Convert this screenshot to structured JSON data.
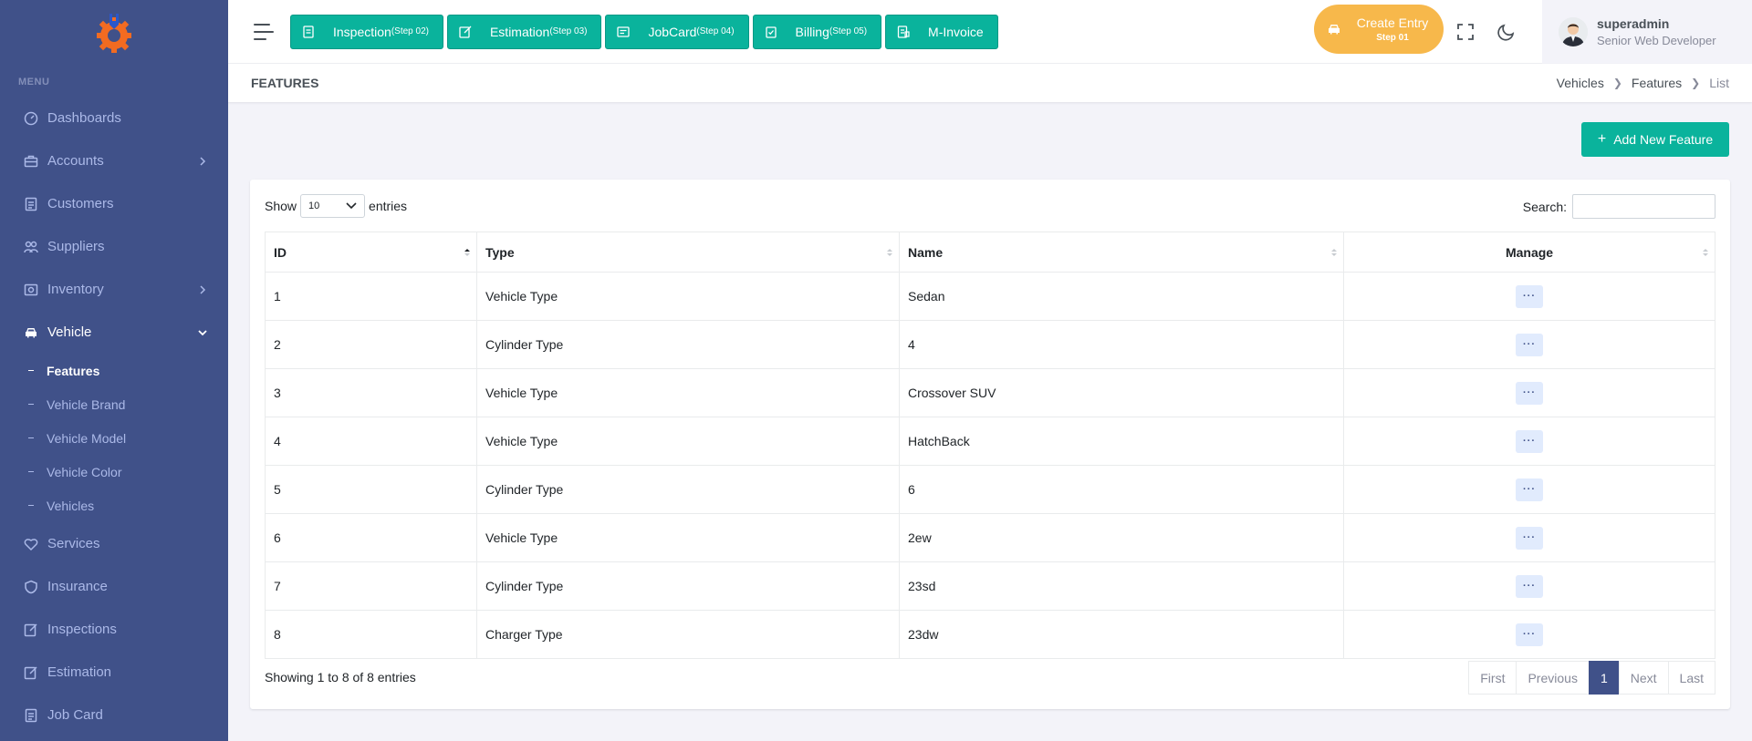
{
  "sidebar": {
    "menu_title": "MENU",
    "items": [
      {
        "label": "Dashboards",
        "icon": "dashboard-icon"
      },
      {
        "label": "Accounts",
        "icon": "briefcase-icon",
        "has_children": true
      },
      {
        "label": "Customers",
        "icon": "file-icon"
      },
      {
        "label": "Suppliers",
        "icon": "users-icon"
      },
      {
        "label": "Inventory",
        "icon": "inventory-icon",
        "has_children": true
      },
      {
        "label": "Vehicle",
        "icon": "car-icon",
        "has_children": true,
        "expanded": true
      },
      {
        "label": "Services",
        "icon": "heart-icon"
      },
      {
        "label": "Insurance",
        "icon": "shield-icon"
      },
      {
        "label": "Inspections",
        "icon": "edit-icon"
      },
      {
        "label": "Estimation",
        "icon": "edit-icon"
      },
      {
        "label": "Job Card",
        "icon": "file-icon"
      }
    ],
    "vehicle_sub": [
      "Features",
      "Vehicle Brand",
      "Vehicle Model",
      "Vehicle Color",
      "Vehicles"
    ]
  },
  "topbar": {
    "steps": [
      {
        "label": "Inspection",
        "step": "(Step 02)"
      },
      {
        "label": "Estimation",
        "step": "(Step 03)"
      },
      {
        "label": "JobCard",
        "step": "(Step 04)"
      },
      {
        "label": "Billing",
        "step": "(Step 05)"
      },
      {
        "label": "M-Invoice",
        "step": ""
      }
    ],
    "create_entry": {
      "label": "Create Entry",
      "step": "Step 01"
    },
    "user": {
      "name": "superadmin",
      "role": "Senior Web Developer"
    }
  },
  "page": {
    "title": "FEATURES",
    "breadcrumb": [
      "Vehicles",
      "Features",
      "List"
    ],
    "add_button": "Add New Feature"
  },
  "table": {
    "show_label": "Show",
    "entries_label": "entries",
    "page_length": "10",
    "search_label": "Search:",
    "columns": [
      "ID",
      "Type",
      "Name",
      "Manage"
    ],
    "rows": [
      {
        "id": "1",
        "type": "Vehicle Type",
        "name": "Sedan"
      },
      {
        "id": "2",
        "type": "Cylinder Type",
        "name": "4"
      },
      {
        "id": "3",
        "type": "Vehicle Type",
        "name": "Crossover SUV"
      },
      {
        "id": "4",
        "type": "Vehicle Type",
        "name": "HatchBack"
      },
      {
        "id": "5",
        "type": "Cylinder Type",
        "name": "6"
      },
      {
        "id": "6",
        "type": "Vehicle Type",
        "name": "2ew"
      },
      {
        "id": "7",
        "type": "Cylinder Type",
        "name": "23sd"
      },
      {
        "id": "8",
        "type": "Charger Type",
        "name": "23dw"
      }
    ],
    "manage_label": "···",
    "info": "Showing 1 to 8 of 8 entries",
    "pagination": [
      "First",
      "Previous",
      "1",
      "Next",
      "Last"
    ]
  }
}
